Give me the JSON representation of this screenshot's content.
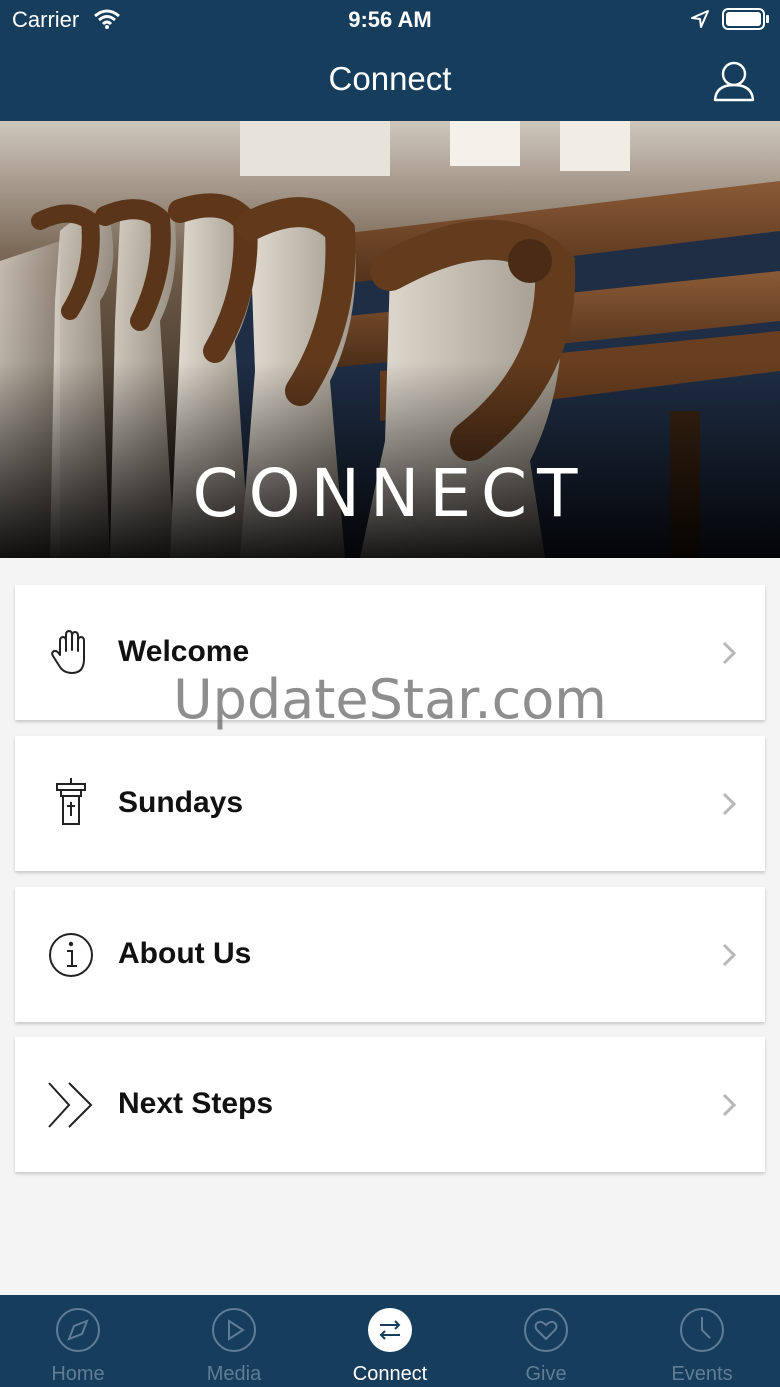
{
  "status_bar": {
    "carrier": "Carrier",
    "time": "9:56 AM"
  },
  "nav": {
    "title": "Connect"
  },
  "hero": {
    "title": "CONNECT"
  },
  "menu": [
    {
      "label": "Welcome",
      "icon": "hand-icon"
    },
    {
      "label": "Sundays",
      "icon": "pulpit-icon"
    },
    {
      "label": "About Us",
      "icon": "info-icon"
    },
    {
      "label": "Next Steps",
      "icon": "double-chevron-icon"
    }
  ],
  "watermark": "UpdateStar.com",
  "tabs": [
    {
      "label": "Home",
      "icon": "compass-icon"
    },
    {
      "label": "Media",
      "icon": "play-icon"
    },
    {
      "label": "Connect",
      "icon": "arrows-exchange-icon",
      "active": true
    },
    {
      "label": "Give",
      "icon": "heart-icon"
    },
    {
      "label": "Events",
      "icon": "clock-icon"
    }
  ],
  "colors": {
    "brand": "#163d5c",
    "tab_inactive": "#5f7d96",
    "background": "#f4f4f4"
  }
}
